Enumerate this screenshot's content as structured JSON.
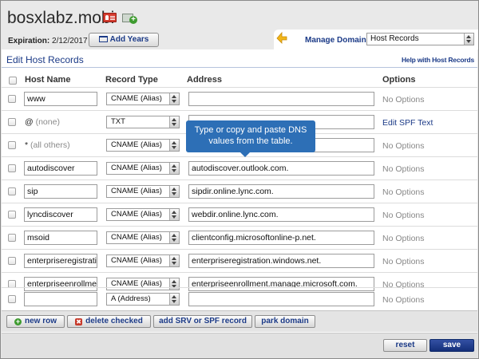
{
  "header": {
    "domain": "bosxlabz.mobi",
    "expiration_label": "Expiration:",
    "expiration_date": "2/12/2017",
    "add_years": "Add Years"
  },
  "manage_domain": {
    "label": "Manage Domain:",
    "selected": "Host Records"
  },
  "panel": {
    "title": "Edit Host Records",
    "help_link": "Help with Host Records"
  },
  "columns": {
    "host_name": "Host Name",
    "record_type": "Record Type",
    "address": "Address",
    "options": "Options"
  },
  "rows": [
    {
      "host": "www",
      "host_static": false,
      "type": "CNAME (Alias)",
      "address": "",
      "options": "No Options",
      "options_link": false
    },
    {
      "host": "@",
      "host_note": "(none)",
      "host_static": true,
      "type": "TXT",
      "address": "",
      "options": "Edit SPF Text",
      "options_link": true
    },
    {
      "host": "*",
      "host_note": "(all others)",
      "host_static": true,
      "type": "CNAME (Alias)",
      "address": "",
      "options": "No Options",
      "options_link": false
    },
    {
      "host": "autodiscover",
      "host_static": false,
      "type": "CNAME (Alias)",
      "address": "autodiscover.outlook.com.",
      "options": "No Options",
      "options_link": false
    },
    {
      "host": "sip",
      "host_static": false,
      "type": "CNAME (Alias)",
      "address": "sipdir.online.lync.com.",
      "options": "No Options",
      "options_link": false
    },
    {
      "host": "lyncdiscover",
      "host_static": false,
      "type": "CNAME (Alias)",
      "address": "webdir.online.lync.com.",
      "options": "No Options",
      "options_link": false
    },
    {
      "host": "msoid",
      "host_static": false,
      "type": "CNAME (Alias)",
      "address": "clientconfig.microsoftonline-p.net.",
      "options": "No Options",
      "options_link": false
    },
    {
      "host": "enterpriseregistration",
      "host_static": false,
      "type": "CNAME (Alias)",
      "address": "enterpriseregistration.windows.net.",
      "options": "No Options",
      "options_link": false
    },
    {
      "host": "enterpriseenrollment",
      "host_static": false,
      "type": "CNAME (Alias)",
      "address": "enterpriseenrollment.manage.microsoft.com.",
      "options": "No Options",
      "options_link": false
    },
    {
      "host": "",
      "host_static": false,
      "type": "A (Address)",
      "address": "",
      "options": "No Options",
      "options_link": false
    }
  ],
  "tooltip": {
    "line1": "Type or copy and paste DNS",
    "line2": "values from the table."
  },
  "actions": {
    "new_row": "new row",
    "delete_checked": "delete checked",
    "add_srv": "add SRV or SPF record",
    "park_domain": "park domain"
  },
  "footer": {
    "reset": "reset",
    "save": "save"
  },
  "colors": {
    "accent": "#1b3a87",
    "tooltip": "#2d6fb6",
    "save": "#142f79"
  }
}
